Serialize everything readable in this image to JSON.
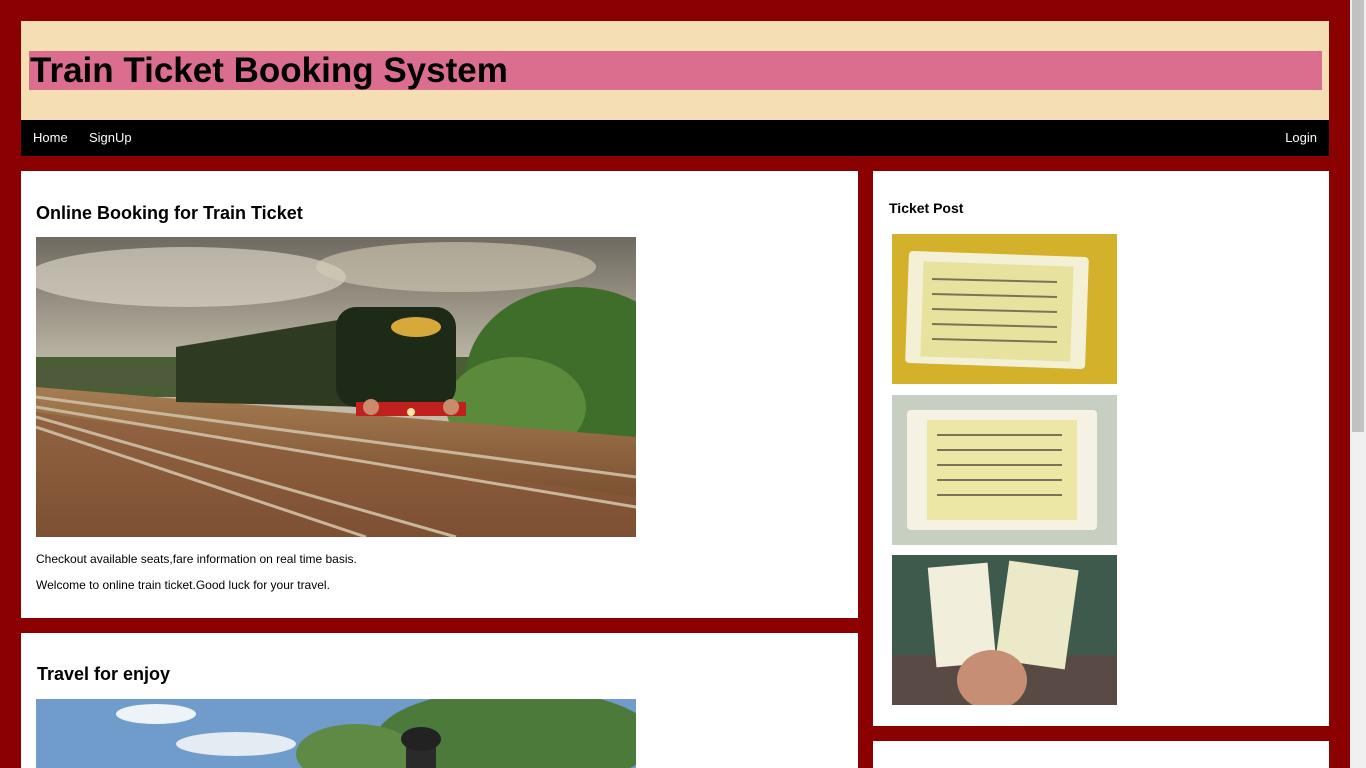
{
  "header": {
    "title": "Train Ticket Booking System"
  },
  "nav": {
    "home": "Home",
    "signup": "SignUp",
    "login": "Login"
  },
  "main": {
    "post1": {
      "title": "Online Booking for Train Ticket",
      "line1": "Checkout available seats,fare information on real time basis.",
      "line2": "Welcome to online train ticket.Good luck for your travel."
    },
    "post2": {
      "title": "Travel for enjoy"
    }
  },
  "sidebar": {
    "title": "Ticket Post"
  },
  "colors": {
    "background": "#8b0000",
    "header": "#f5deb3",
    "title_bar": "#db6e8f",
    "nav": "#000000"
  }
}
